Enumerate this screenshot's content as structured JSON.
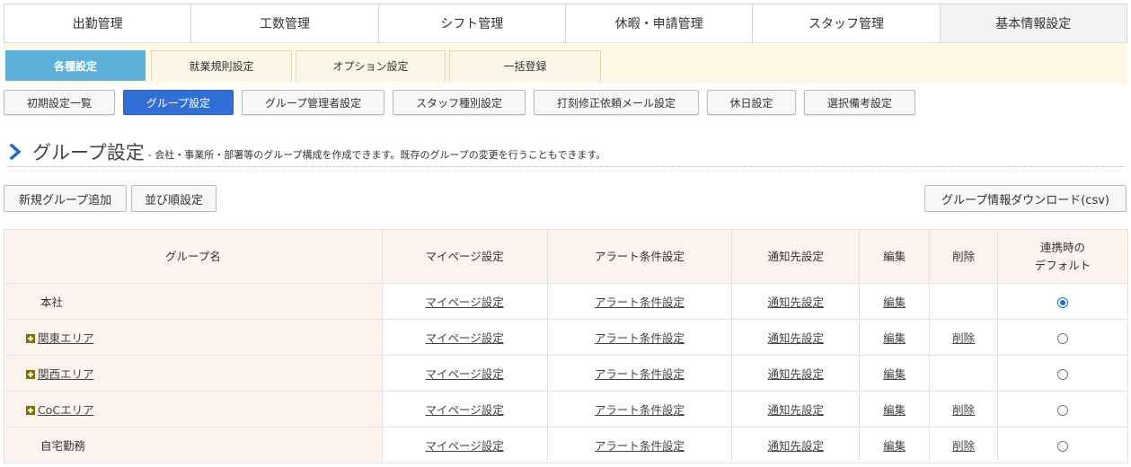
{
  "top_tabs": [
    {
      "label": "出勤管理"
    },
    {
      "label": "工数管理"
    },
    {
      "label": "シフト管理"
    },
    {
      "label": "休暇・申請管理"
    },
    {
      "label": "スタッフ管理"
    },
    {
      "label": "基本情報設定",
      "active": true
    }
  ],
  "sub_tabs": [
    {
      "label": "各種設定",
      "active": true
    },
    {
      "label": "就業規則設定"
    },
    {
      "label": "オプション設定"
    },
    {
      "label": "一括登録"
    }
  ],
  "setting_buttons": [
    {
      "label": "初期設定一覧"
    },
    {
      "label": "グループ設定",
      "active": true
    },
    {
      "label": "グループ管理者設定"
    },
    {
      "label": "スタッフ種別設定"
    },
    {
      "label": "打刻修正依頼メール設定"
    },
    {
      "label": "休日設定"
    },
    {
      "label": "選択備考設定"
    }
  ],
  "heading": {
    "title": "グループ設定",
    "description": "- 会社・事業所・部署等のグループ構成を作成できます。既存のグループの変更を行うこともできます。"
  },
  "actions": {
    "add_group": "新規グループ追加",
    "sort_order": "並び順設定",
    "download_csv": "グループ情報ダウンロード(csv)"
  },
  "table": {
    "headers": {
      "group_name": "グループ名",
      "mypage": "マイページ設定",
      "alert": "アラート条件設定",
      "notify": "通知先設定",
      "edit": "編集",
      "delete": "削除",
      "default_line1": "連携時の",
      "default_line2": "デフォルト"
    },
    "rows": [
      {
        "name": "本社",
        "expandable": false,
        "mypage": "マイページ設定",
        "alert": "アラート条件設定",
        "notify": "通知先設定",
        "edit": "編集",
        "delete": "",
        "default_selected": true
      },
      {
        "name": "関東エリア",
        "expandable": true,
        "mypage": "マイページ設定",
        "alert": "アラート条件設定",
        "notify": "通知先設定",
        "edit": "編集",
        "delete": "削除",
        "default_selected": false
      },
      {
        "name": "関西エリア",
        "expandable": true,
        "mypage": "マイページ設定",
        "alert": "アラート条件設定",
        "notify": "通知先設定",
        "edit": "編集",
        "delete": "",
        "default_selected": false
      },
      {
        "name": "CoCエリア",
        "expandable": true,
        "mypage": "マイページ設定",
        "alert": "アラート条件設定",
        "notify": "通知先設定",
        "edit": "編集",
        "delete": "削除",
        "default_selected": false
      },
      {
        "name": "自宅勤務",
        "expandable": false,
        "mypage": "マイページ設定",
        "alert": "アラート条件設定",
        "notify": "通知先設定",
        "edit": "編集",
        "delete": "削除",
        "default_selected": false
      }
    ]
  },
  "colors": {
    "accent_blue": "#2f6fd6",
    "sub_tab_active": "#5fb0d8",
    "heading_chevron": "#1e6ad6",
    "table_header_bg": "#fdf3ee",
    "sub_bar_bg": "#fdf7e6"
  }
}
